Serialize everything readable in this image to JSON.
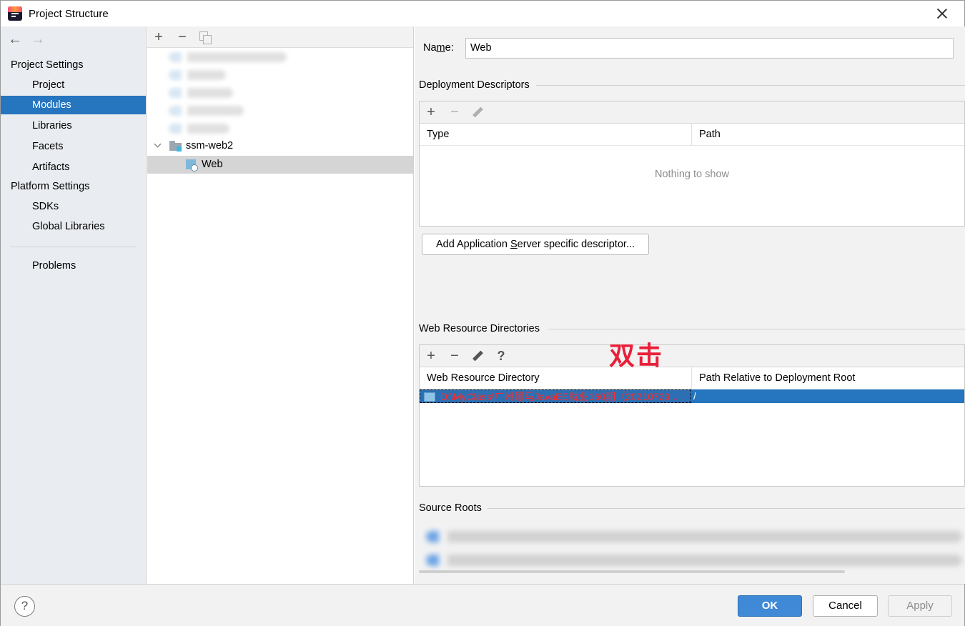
{
  "window": {
    "title": "Project Structure"
  },
  "sidebar": {
    "project_settings_label": "Project Settings",
    "project_items": [
      "Project",
      "Modules",
      "Libraries",
      "Facets",
      "Artifacts"
    ],
    "platform_settings_label": "Platform Settings",
    "platform_items": [
      "SDKs",
      "Global Libraries"
    ],
    "problems_label": "Problems",
    "selected": "Modules"
  },
  "tree": {
    "module_name": "ssm-web2",
    "facet_name": "Web"
  },
  "details": {
    "name_label_pre": "Na",
    "name_label_mnemonic": "m",
    "name_label_post": "e:",
    "name_value": "Web",
    "deployment_descriptors_title": "Deployment Descriptors",
    "dd_columns": [
      "Type",
      "Path"
    ],
    "dd_empty": "Nothing to show",
    "add_descriptor_pre": "Add Application ",
    "add_descriptor_mnemonic": "S",
    "add_descriptor_post": "erver specific descriptor...",
    "web_resource_title": "Web Resource Directories",
    "wr_columns": [
      "Web Resource Directory",
      "Path Relative to Deployment Root"
    ],
    "wr_row": {
      "directory": "D:\\MyClass\\广州黑马JavaEE就业160期（20210729...",
      "relative_path": "/"
    },
    "annotation": "双击",
    "source_roots_title": "Source Roots"
  },
  "footer": {
    "help": "?",
    "ok": "OK",
    "cancel": "Cancel",
    "apply": "Apply"
  },
  "colors": {
    "selection": "#2675bf",
    "ok_button": "#3f89d6",
    "annotation": "#e8203a"
  }
}
